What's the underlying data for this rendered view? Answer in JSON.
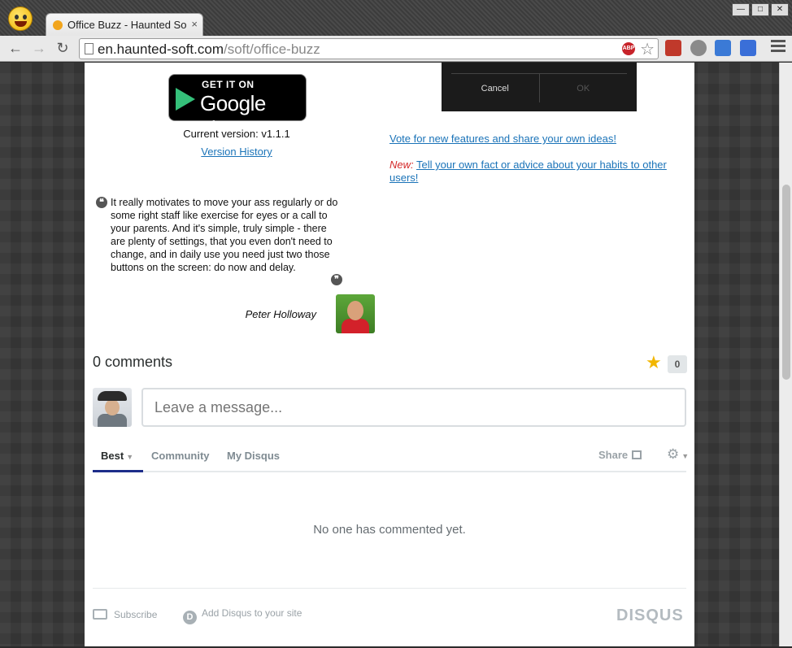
{
  "browser": {
    "tab_title": "Office Buzz - Haunted So",
    "tab_close": "×",
    "url_host": "en.haunted-soft.com",
    "url_path": "/soft/office-buzz",
    "abp_label": "ABP",
    "window_buttons": [
      "—",
      "□",
      "✕"
    ]
  },
  "app": {
    "gplay_get": "GET IT ON",
    "gplay_brand": "Google play",
    "version": "Current version: v1.1.1",
    "history_link": "Version History",
    "dialog_cancel": "Cancel",
    "dialog_ok": "OK",
    "vote_link": "Vote for new features and share your own ideas!",
    "new_tag": "New:",
    "new_link": "Tell your own fact or advice about your habits to other users!"
  },
  "testimonial": {
    "text": "It really motivates to move your ass regularly or do some right staff like exercise for eyes or a call to your parents. And it's simple, truly simple - there are plenty of settings, that you even don't need to change, and in daily use you need just two those buttons on the screen: do now and delay.",
    "author": "Peter Holloway",
    "open_quote": "❝",
    "close_quote": "❞"
  },
  "disqus": {
    "comments_count": "0 comments",
    "star": "★",
    "star_count": "0",
    "input_placeholder": "Leave a message...",
    "tabs": [
      "Best",
      "Community",
      "My Disqus"
    ],
    "share": "Share",
    "gear": "⚙",
    "empty": "No one has commented yet.",
    "subscribe": "Subscribe",
    "add_disqus": "Add Disqus to your site",
    "d_letter": "D",
    "logo": "DISQUS"
  }
}
